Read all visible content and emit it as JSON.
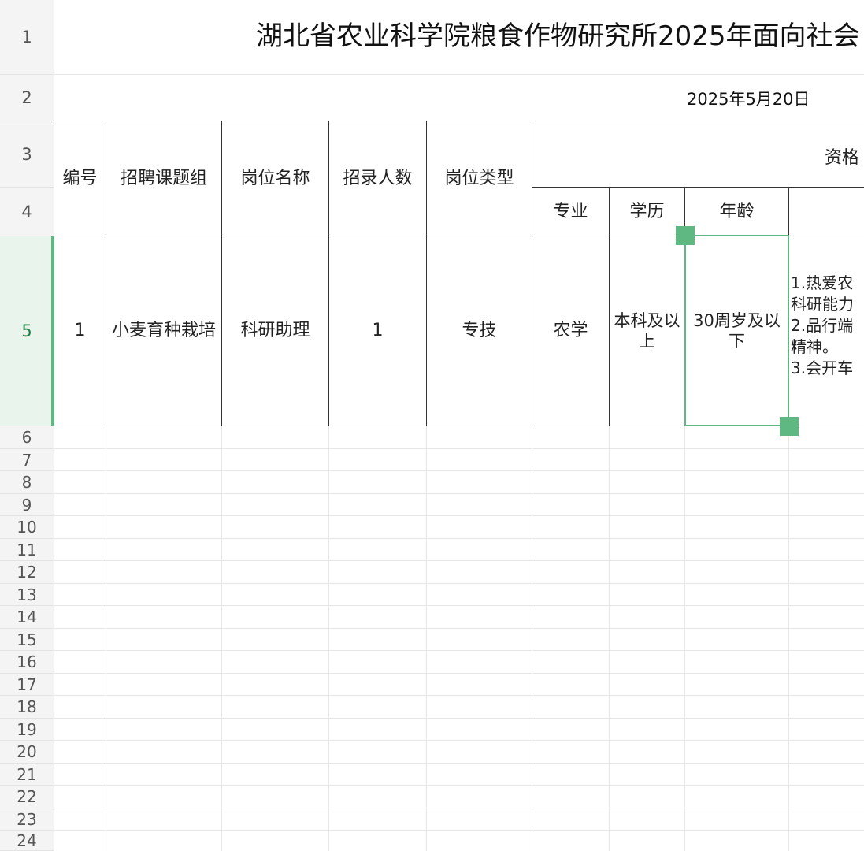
{
  "sheet": {
    "title": "湖北省农业科学院粮食作物研究所2025年面向社会",
    "date": "2025年5月20日",
    "row_numbers": [
      "1",
      "2",
      "3",
      "4",
      "5",
      "6",
      "7",
      "8",
      "9",
      "10",
      "11",
      "12",
      "13",
      "14",
      "15",
      "16",
      "17",
      "18",
      "19",
      "20",
      "21",
      "22",
      "23",
      "24"
    ],
    "headers": {
      "id": "编号",
      "group": "招聘课题组",
      "position_name": "岗位名称",
      "hire_count": "招录人数",
      "position_type": "岗位类型",
      "qualifications": "资格",
      "major": "专业",
      "education": "学历",
      "age": "年龄"
    },
    "row5": {
      "id": "1",
      "group": "小麦育种栽培",
      "position_name": "科研助理",
      "hire_count": "1",
      "position_type": "专技",
      "major": "农学",
      "education": "本科及以上",
      "age": "30周岁及以下",
      "other_requirements": [
        "1.热爱农",
        "科研能力",
        "2.品行端",
        "精神。",
        "3.会开车"
      ]
    }
  },
  "colors": {
    "selection": "#5fb882",
    "border": "#333333",
    "grid": "#e6e6e6"
  }
}
